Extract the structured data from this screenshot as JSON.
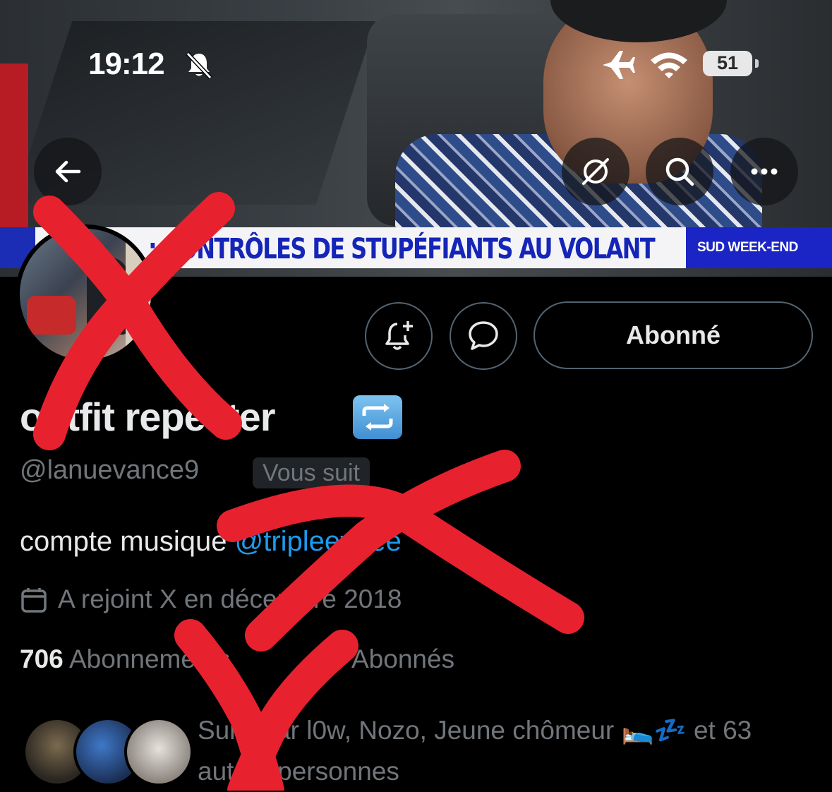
{
  "status_bar": {
    "time": "19:12",
    "battery": "51",
    "icons": [
      "bell-slash-icon",
      "airplane-icon",
      "wifi-icon",
      "battery-icon"
    ]
  },
  "banner": {
    "ticker_headline": ": CONTRÔLES DE STUPÉFIANTS AU VOLANT",
    "ticker_brand": "SUD WEEK-END"
  },
  "nav": {
    "icons": [
      "back-arrow-icon",
      "grok-icon",
      "search-icon",
      "more-icon"
    ]
  },
  "actions": {
    "follow_label": "Abonné",
    "icons": [
      "notification-bell-plus-icon",
      "message-icon"
    ]
  },
  "profile": {
    "display_name": "outfit repeater",
    "name_emoji": "🔁",
    "handle": "@lanuevance9",
    "follows_you": "Vous suit",
    "bio_text": "compte musique ",
    "bio_mention": "@tripleeveee",
    "joined": "A rejoint X en décembre 2018",
    "following_count": "706",
    "following_label": "Abonnements",
    "followers_label": "Abonnés",
    "mutuals_text": "Suivi par l0w, Nozo, Jeune chômeur 🛌💤 et 63 autres personnes"
  },
  "colors": {
    "background": "#000000",
    "text_primary": "#e7e9ea",
    "text_secondary": "#71767b",
    "link": "#1d9bf0",
    "border": "#536471",
    "scribble": "#e8212f"
  }
}
